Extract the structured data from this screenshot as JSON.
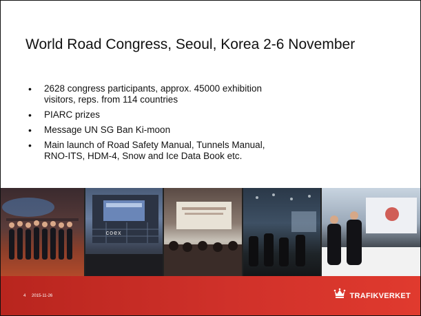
{
  "slide": {
    "title": "World Road Congress, Seoul, Korea 2-6 November",
    "bullets": [
      "2628 congress participants, approx. 45000 exhibition\nvisitors, reps. from 114 countries",
      "PIARC prizes",
      "Message UN SG Ban Ki-moon",
      "Main launch of Road Safety Manual, Tunnels Manual,\nRNO-ITS, HDM-4, Snow and Ice Data Book etc."
    ],
    "photo_sign": "coex"
  },
  "footer": {
    "slide_number": "4",
    "date": "2015-11-26",
    "brand_name": "TRAFIKVERKET",
    "brand_icon": "crown-icon",
    "color": "#d0312a"
  }
}
